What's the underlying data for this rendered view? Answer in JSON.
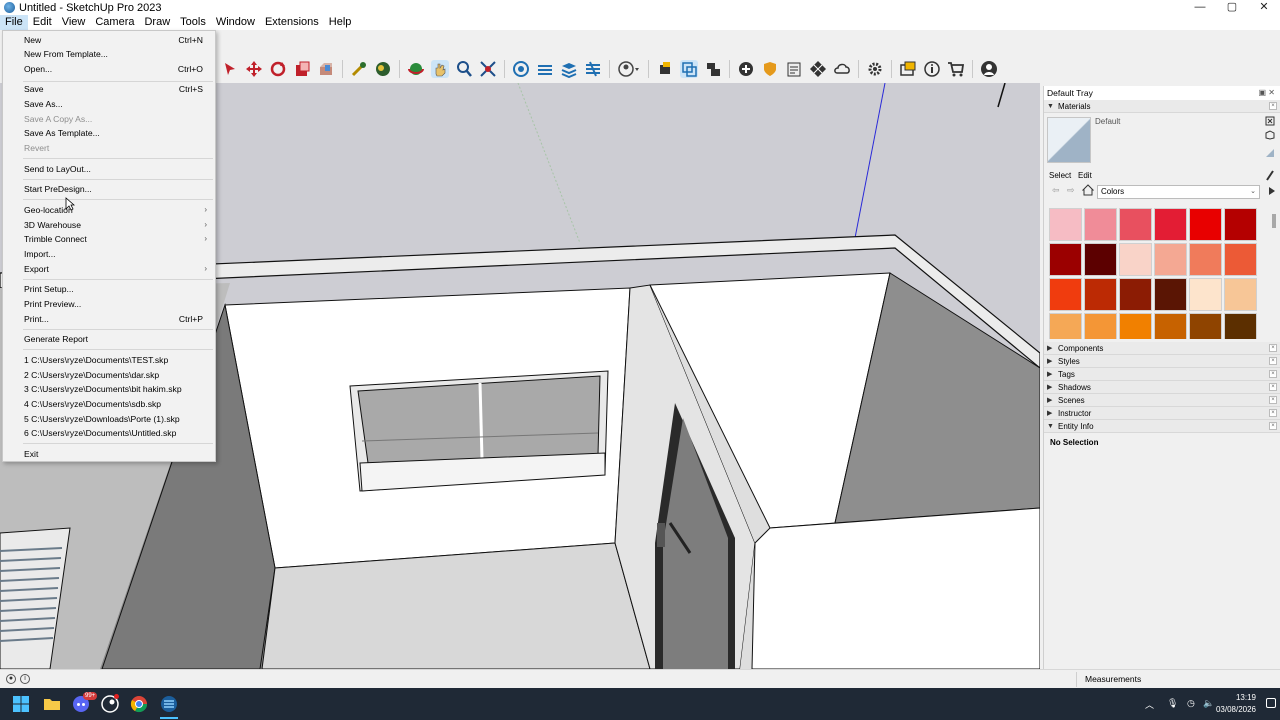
{
  "window": {
    "title": "Untitled - SketchUp Pro 2023",
    "controls": {
      "minimize": "—",
      "maximize": "▢",
      "close": "✕"
    }
  },
  "menubar": [
    "File",
    "Edit",
    "View",
    "Camera",
    "Draw",
    "Tools",
    "Window",
    "Extensions",
    "Help"
  ],
  "file_menu": {
    "items": [
      {
        "label": "New",
        "shortcut": "Ctrl+N"
      },
      {
        "label": "New From Template...",
        "shortcut": ""
      },
      {
        "label": "Open...",
        "shortcut": "Ctrl+O"
      },
      {
        "label": "Save",
        "shortcut": "Ctrl+S"
      },
      {
        "label": "Save As...",
        "shortcut": ""
      },
      {
        "label": "Save A Copy As...",
        "shortcut": "",
        "disabled": true
      },
      {
        "label": "Save As Template...",
        "shortcut": ""
      },
      {
        "label": "Revert",
        "shortcut": "",
        "disabled": true
      },
      {
        "label": "Send to LayOut...",
        "shortcut": ""
      },
      {
        "label": "Start PreDesign...",
        "shortcut": ""
      },
      {
        "label": "Geo-location",
        "submenu": true
      },
      {
        "label": "3D Warehouse",
        "submenu": true
      },
      {
        "label": "Trimble Connect",
        "submenu": true
      },
      {
        "label": "Import...",
        "shortcut": ""
      },
      {
        "label": "Export",
        "submenu": true
      },
      {
        "label": "Print Setup...",
        "shortcut": ""
      },
      {
        "label": "Print Preview...",
        "shortcut": ""
      },
      {
        "label": "Print...",
        "shortcut": "Ctrl+P"
      },
      {
        "label": "Generate Report",
        "shortcut": ""
      },
      {
        "label": "1 C:\\Users\\ryze\\Documents\\TEST.skp",
        "shortcut": ""
      },
      {
        "label": "2 C:\\Users\\ryze\\Documents\\dar.skp",
        "shortcut": ""
      },
      {
        "label": "3 C:\\Users\\ryze\\Documents\\bit hakim.skp",
        "shortcut": ""
      },
      {
        "label": "4 C:\\Users\\ryze\\Documents\\sdb.skp",
        "shortcut": ""
      },
      {
        "label": "5 C:\\Users\\ryze\\Downloads\\Porte (1).skp",
        "shortcut": ""
      },
      {
        "label": "6 C:\\Users\\ryze\\Documents\\Untitled.skp",
        "shortcut": ""
      },
      {
        "label": "Exit",
        "shortcut": ""
      }
    ]
  },
  "tray": {
    "title": "Default Tray",
    "materials": {
      "header": "Materials",
      "current": "Default",
      "tab_select": "Select",
      "tab_edit": "Edit",
      "collection": "Colors",
      "swatches": [
        "#f6bcc4",
        "#f08c98",
        "#e8505f",
        "#e31d34",
        "#e80000",
        "#b40000",
        "#9b0000",
        "#5c0000",
        "#f9d3c8",
        "#f4a893",
        "#f07b5b",
        "#ec5a36",
        "#f03c0e",
        "#bc2a04",
        "#8c1c04",
        "#5a1504",
        "#fde4cc",
        "#f7c697",
        "#f5a856",
        "#f49636",
        "#f18000",
        "#c76200",
        "#8f4400",
        "#5c2f00"
      ]
    },
    "panels": [
      "Components",
      "Styles",
      "Tags",
      "Shadows",
      "Scenes",
      "Instructor"
    ],
    "entity_info": {
      "header": "Entity Info",
      "status": "No Selection"
    }
  },
  "statusbar": {
    "measurements_label": "Measurements"
  },
  "taskbar": {
    "time": "13:19",
    "date": "03/08/2026",
    "notification_badge": "99+"
  }
}
